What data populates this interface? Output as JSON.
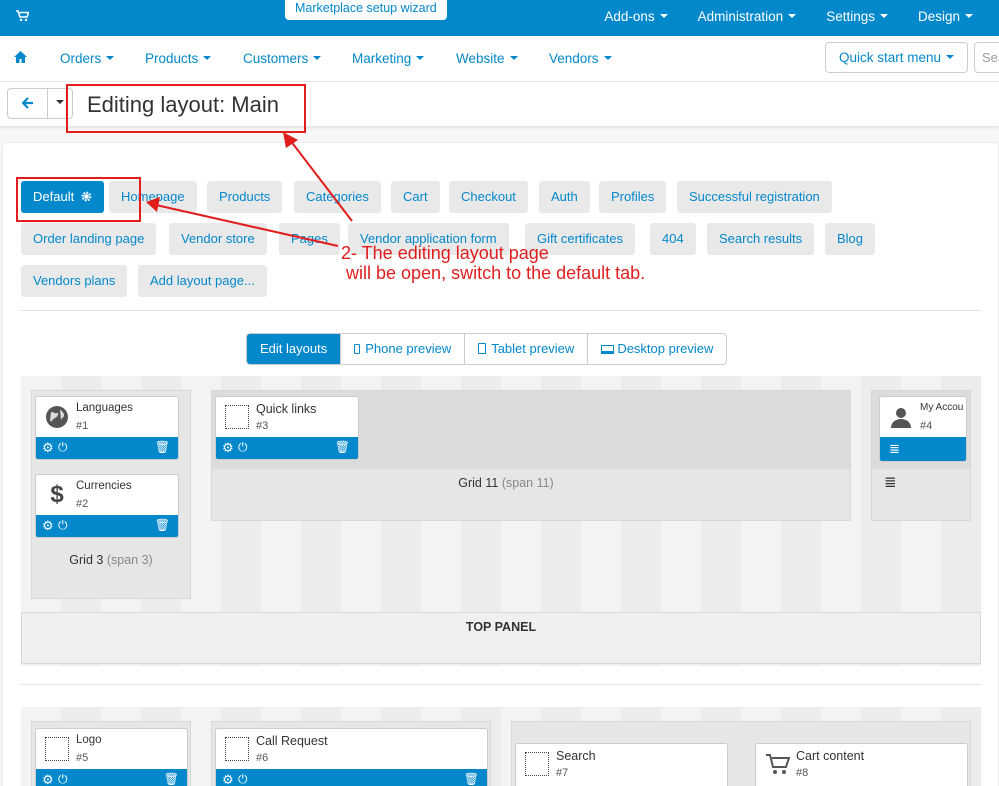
{
  "topbar": {
    "wizard_label": "Marketplace setup wizard",
    "items": [
      "Add-ons",
      "Administration",
      "Settings",
      "Design"
    ]
  },
  "mainnav": {
    "items": [
      "Orders",
      "Products",
      "Customers",
      "Marketing",
      "Website",
      "Vendors"
    ],
    "quick_start_label": "Quick start menu",
    "search_placeholder": "Search"
  },
  "page": {
    "title": "Editing layout: Main"
  },
  "layout_tabs": [
    "Default",
    "Homepage",
    "Products",
    "Categories",
    "Cart",
    "Checkout",
    "Auth",
    "Profiles",
    "Successful registration",
    "Order landing page",
    "Vendor store",
    "Pages",
    "Vendor application form",
    "Gift certificates",
    "404",
    "Search results",
    "Blog",
    "Vendors plans",
    "Add layout page..."
  ],
  "preview_modes": [
    "Edit layouts",
    "Phone preview",
    "Tablet preview",
    "Desktop preview"
  ],
  "grids": {
    "grid3": {
      "name": "Grid 3",
      "span": "(span 3)"
    },
    "grid11": {
      "name": "Grid 11",
      "span": "(span 11)"
    }
  },
  "blocks": {
    "languages": {
      "name": "Languages",
      "num": "#1"
    },
    "currencies": {
      "name": "Currencies",
      "num": "#2"
    },
    "quick_links": {
      "name": "Quick links",
      "num": "#3"
    },
    "my_account": {
      "name": "My Accou",
      "num": "#4"
    },
    "logo": {
      "name": "Logo",
      "num": "#5"
    },
    "call_request": {
      "name": "Call Request",
      "num": "#6"
    },
    "search": {
      "name": "Search",
      "num": "#7"
    },
    "cart_content": {
      "name": "Cart content",
      "num": "#8"
    }
  },
  "top_panel_label": "TOP PANEL",
  "annotation": {
    "text": "2- The editing layout page\n will be open, switch to the default tab."
  },
  "colors": {
    "accent": "#0388cc",
    "annotation": "#e01e1e"
  }
}
